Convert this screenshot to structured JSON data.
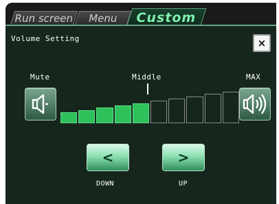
{
  "tabs": [
    {
      "label": "Run screen",
      "active": false
    },
    {
      "label": "Menu",
      "active": false
    },
    {
      "label": "Custom",
      "active": true
    }
  ],
  "dialog": {
    "title": "Volume Setting",
    "close_glyph": "×"
  },
  "labels": {
    "mute": "Mute",
    "middle": "Middle",
    "max": "MAX"
  },
  "volume": {
    "level": 5,
    "max": 10
  },
  "icons": {
    "mute_button": "speaker-mute-icon",
    "max_button": "speaker-loud-icon",
    "down_button": "chevron-left-icon",
    "up_button": "chevron-right-icon"
  },
  "buttons": {
    "down_glyph": "<",
    "up_glyph": ">",
    "down_label": "DOWN",
    "up_label": "UP"
  },
  "colors": {
    "accent": "#7ff0b0",
    "segment_on": "#2ec05a",
    "segment_off_border": "#8a8a8a",
    "panel_bg": "#16261d"
  }
}
